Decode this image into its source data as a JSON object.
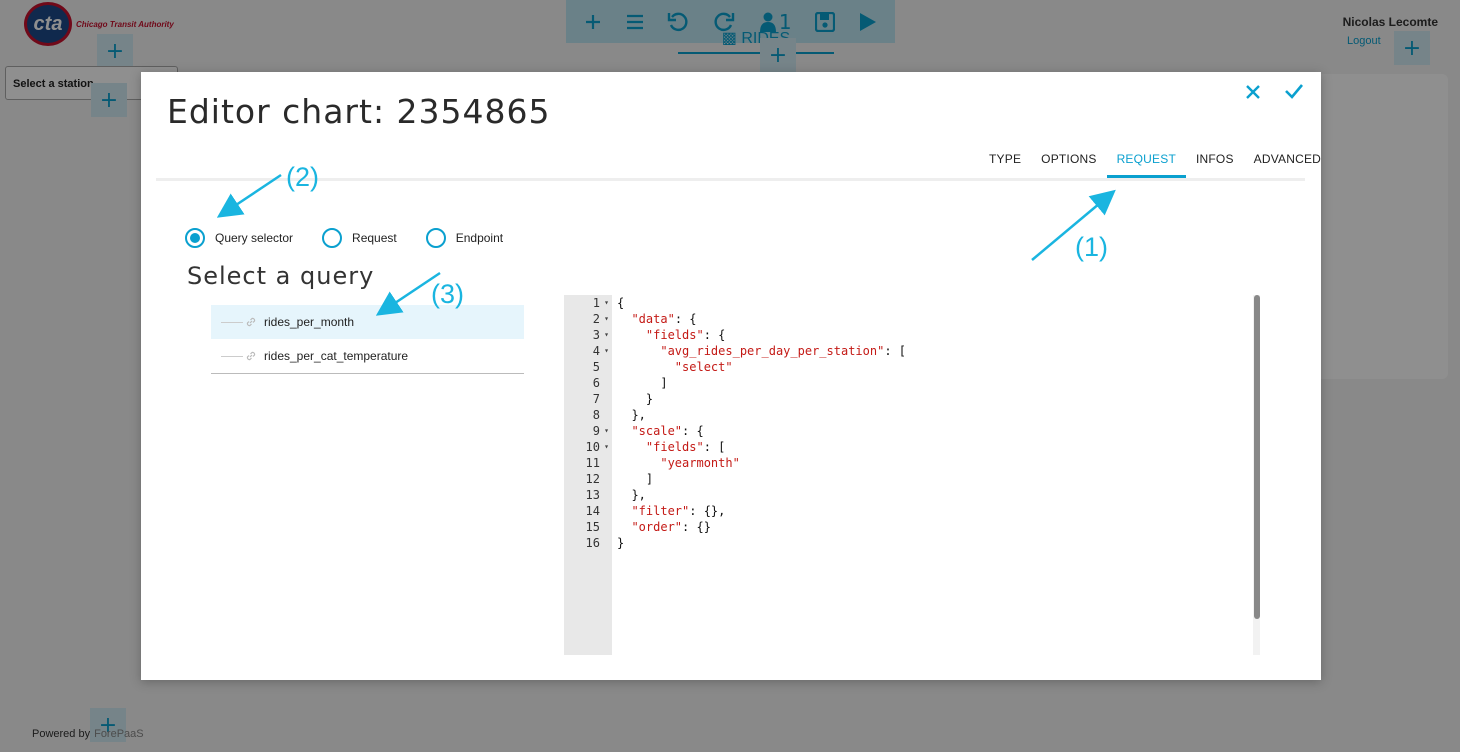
{
  "background": {
    "logo_mark": "cta",
    "logo_text": "Chicago Transit Authority",
    "toolbar": {
      "users_count": "1"
    },
    "rides_tab": "RIDES",
    "user_name": "Nicolas Lecomte",
    "logout": "Logout",
    "station_select": "Select a station...",
    "powered_by": "Powered by",
    "powered_brand": "ForePaaS"
  },
  "modal": {
    "title": "Editor chart: 2354865",
    "tabs": [
      {
        "label": "TYPE",
        "active": false
      },
      {
        "label": "OPTIONS",
        "active": false
      },
      {
        "label": "REQUEST",
        "active": true
      },
      {
        "label": "INFOS",
        "active": false
      },
      {
        "label": "ADVANCED",
        "active": false
      }
    ],
    "radios": [
      {
        "label": "Query selector",
        "checked": true
      },
      {
        "label": "Request",
        "checked": false
      },
      {
        "label": "Endpoint",
        "checked": false
      }
    ],
    "select_heading": "Select a query",
    "queries": [
      {
        "label": "rides_per_month",
        "selected": true
      },
      {
        "label": "rides_per_cat_temperature",
        "selected": false
      }
    ],
    "editor": {
      "line_numbers": [
        "1",
        "2",
        "3",
        "4",
        "5",
        "6",
        "7",
        "8",
        "9",
        "10",
        "11",
        "12",
        "13",
        "14",
        "15",
        "16"
      ],
      "foldable_lines": [
        1,
        2,
        3,
        4,
        9,
        10
      ],
      "lines": [
        [
          {
            "t": "{",
            "k": false
          }
        ],
        [
          {
            "t": "  ",
            "k": false
          },
          {
            "t": "\"data\"",
            "k": true
          },
          {
            "t": ": {",
            "k": false
          }
        ],
        [
          {
            "t": "    ",
            "k": false
          },
          {
            "t": "\"fields\"",
            "k": true
          },
          {
            "t": ": {",
            "k": false
          }
        ],
        [
          {
            "t": "      ",
            "k": false
          },
          {
            "t": "\"avg_rides_per_day_per_station\"",
            "k": true
          },
          {
            "t": ": [",
            "k": false
          }
        ],
        [
          {
            "t": "        ",
            "k": false
          },
          {
            "t": "\"select\"",
            "k": true
          }
        ],
        [
          {
            "t": "      ]",
            "k": false
          }
        ],
        [
          {
            "t": "    }",
            "k": false
          }
        ],
        [
          {
            "t": "  },",
            "k": false
          }
        ],
        [
          {
            "t": "  ",
            "k": false
          },
          {
            "t": "\"scale\"",
            "k": true
          },
          {
            "t": ": {",
            "k": false
          }
        ],
        [
          {
            "t": "    ",
            "k": false
          },
          {
            "t": "\"fields\"",
            "k": true
          },
          {
            "t": ": [",
            "k": false
          }
        ],
        [
          {
            "t": "      ",
            "k": false
          },
          {
            "t": "\"yearmonth\"",
            "k": true
          }
        ],
        [
          {
            "t": "    ]",
            "k": false
          }
        ],
        [
          {
            "t": "  },",
            "k": false
          }
        ],
        [
          {
            "t": "  ",
            "k": false
          },
          {
            "t": "\"filter\"",
            "k": true
          },
          {
            "t": ": {},",
            "k": false
          }
        ],
        [
          {
            "t": "  ",
            "k": false
          },
          {
            "t": "\"order\"",
            "k": true
          },
          {
            "t": ": {}",
            "k": false
          }
        ],
        [
          {
            "t": "}",
            "k": false
          }
        ]
      ]
    }
  },
  "annotations": {
    "a1": "(1)",
    "a2": "(2)",
    "a3": "(3)"
  },
  "colors": {
    "accent": "#0aa0cf",
    "annotation": "#1ab5e0",
    "json_key": "#c41a16"
  },
  "icons": [
    "plus-icon",
    "menu-icon",
    "undo-icon",
    "redo-icon",
    "user-icon",
    "save-icon",
    "play-icon",
    "close-icon",
    "check-icon",
    "link-icon",
    "chart-icon"
  ]
}
